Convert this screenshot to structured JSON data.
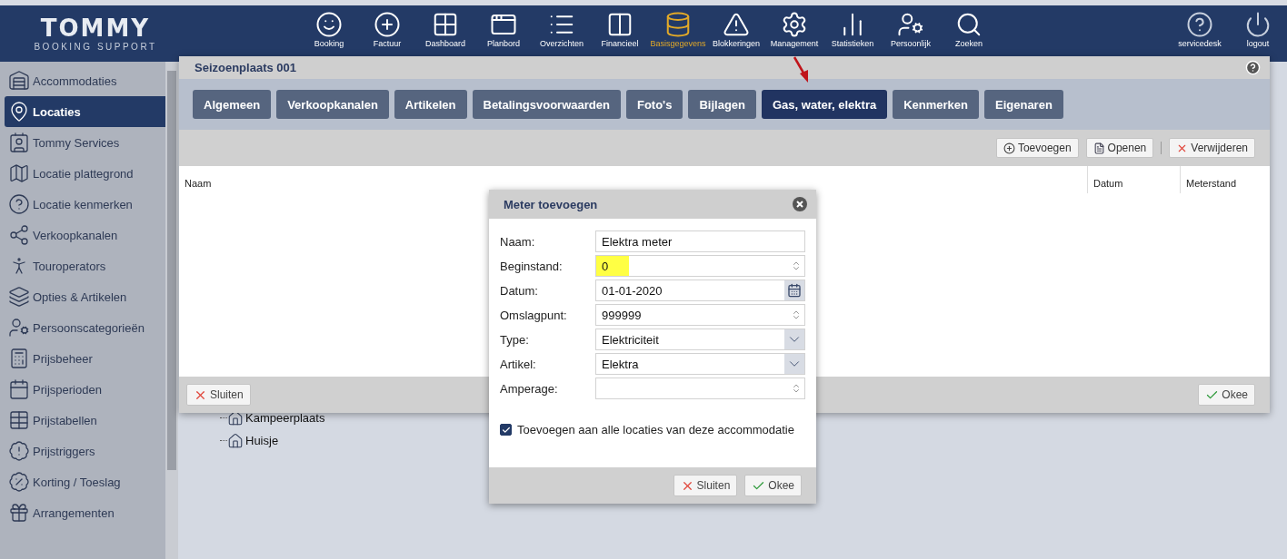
{
  "logo": {
    "name": "TOMMY",
    "tagline": "BOOKING SUPPORT"
  },
  "nav": [
    {
      "label": "Booking",
      "kind": "smile",
      "selected": false
    },
    {
      "label": "Factuur",
      "kind": "plus",
      "selected": false
    },
    {
      "label": "Dashboard",
      "kind": "grid",
      "selected": false
    },
    {
      "label": "Planbord",
      "kind": "window",
      "selected": false
    },
    {
      "label": "Overzichten",
      "kind": "list",
      "selected": false
    },
    {
      "label": "Financieel",
      "kind": "columns",
      "selected": false
    },
    {
      "label": "Basisgegevens",
      "kind": "database",
      "selected": true
    },
    {
      "label": "Blokkeringen",
      "kind": "warning",
      "selected": false
    },
    {
      "label": "Management",
      "kind": "gear",
      "selected": false
    },
    {
      "label": "Statistieken",
      "kind": "chart",
      "selected": false
    },
    {
      "label": "Persoonlijk",
      "kind": "usergear",
      "selected": false
    },
    {
      "label": "Zoeken",
      "kind": "search",
      "selected": false
    }
  ],
  "nav_right": [
    {
      "label": "servicedesk",
      "kind": "help"
    },
    {
      "label": "logout",
      "kind": "power"
    }
  ],
  "sidebar": [
    {
      "label": "Accommodaties",
      "kind": "warehouse",
      "selected": false
    },
    {
      "label": "Locaties",
      "kind": "pin",
      "selected": true
    },
    {
      "label": "Tommy Services",
      "kind": "badge",
      "selected": false
    },
    {
      "label": "Locatie plattegrond",
      "kind": "map",
      "selected": false
    },
    {
      "label": "Locatie kenmerken",
      "kind": "question",
      "selected": false
    },
    {
      "label": "Verkoopkanalen",
      "kind": "network",
      "selected": false
    },
    {
      "label": "Touroperators",
      "kind": "person",
      "selected": false
    },
    {
      "label": "Opties & Artikelen",
      "kind": "layers",
      "selected": false
    },
    {
      "label": "Persoonscategorieën",
      "kind": "usergear",
      "selected": false
    },
    {
      "label": "Prijsbeheer",
      "kind": "abacus",
      "selected": false
    },
    {
      "label": "Prijsperioden",
      "kind": "calendar",
      "selected": false
    },
    {
      "label": "Prijstabellen",
      "kind": "table",
      "selected": false
    },
    {
      "label": "Prijstriggers",
      "kind": "alert",
      "selected": false
    },
    {
      "label": "Korting / Toeslag",
      "kind": "percent",
      "selected": false
    },
    {
      "label": "Arrangementen",
      "kind": "gift",
      "selected": false
    }
  ],
  "tree": [
    "Kampeerplaats",
    "Huisje"
  ],
  "dialog": {
    "title": "Seizoenplaats 001",
    "tabs": [
      {
        "label": "Algemeen",
        "selected": false
      },
      {
        "label": "Verkoopkanalen",
        "selected": false
      },
      {
        "label": "Artikelen",
        "selected": false
      },
      {
        "label": "Betalingsvoorwaarden",
        "selected": false
      },
      {
        "label": "Foto's",
        "selected": false
      },
      {
        "label": "Bijlagen",
        "selected": false
      },
      {
        "label": "Gas, water, elektra",
        "selected": true
      },
      {
        "label": "Kenmerken",
        "selected": false
      },
      {
        "label": "Eigenaren",
        "selected": false
      }
    ],
    "toolbar": [
      {
        "label": "Toevoegen",
        "kind": "add"
      },
      {
        "label": "Openen",
        "kind": "open"
      },
      {
        "label": "Verwijderen",
        "kind": "delete"
      }
    ],
    "columns": [
      "Naam",
      "Datum",
      "Meterstand"
    ],
    "footer": [
      {
        "label": "Sluiten",
        "kind": "close"
      },
      {
        "label": "Okee",
        "kind": "ok"
      }
    ]
  },
  "meter_dialog": {
    "title": "Meter toevoegen",
    "fields": [
      {
        "label": "Naam:",
        "kind": "text",
        "value": "Elektra meter",
        "highlighted": false
      },
      {
        "label": "Beginstand:",
        "kind": "number",
        "value": "0",
        "highlighted": true
      },
      {
        "label": "Datum:",
        "kind": "date",
        "value": "01-01-2020",
        "highlighted": false
      },
      {
        "label": "Omslagpunt:",
        "kind": "number",
        "value": "999999",
        "highlighted": false
      },
      {
        "label": "Type:",
        "kind": "select",
        "value": "Elektriciteit",
        "highlighted": false
      },
      {
        "label": "Artikel:",
        "kind": "select",
        "value": "Elektra",
        "highlighted": false
      },
      {
        "label": "Amperage:",
        "kind": "number",
        "highlighted": false
      }
    ],
    "checkbox": {
      "label": "Toevoegen aan alle locaties van deze accommodatie",
      "checked": true
    },
    "buttons": [
      {
        "label": "Sluiten",
        "kind": "close"
      },
      {
        "label": "Okee",
        "kind": "ok"
      }
    ]
  }
}
